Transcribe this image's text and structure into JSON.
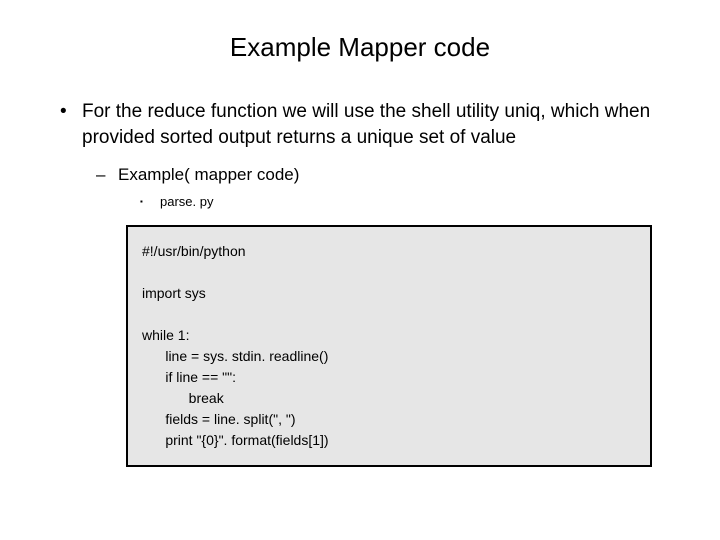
{
  "title": "Example Mapper code",
  "bullets": {
    "l1": "For the reduce function we will use the shell utility uniq, which when provided sorted output returns a unique set of value",
    "l2": "Example( mapper code)",
    "l3": "parse. py"
  },
  "code": "#!/usr/bin/python\n\nimport sys\n\nwhile 1:\n      line = sys. stdin. readline()\n      if line == \"\":\n            break\n      fields = line. split(\", \")\n      print \"{0}\". format(fields[1])"
}
